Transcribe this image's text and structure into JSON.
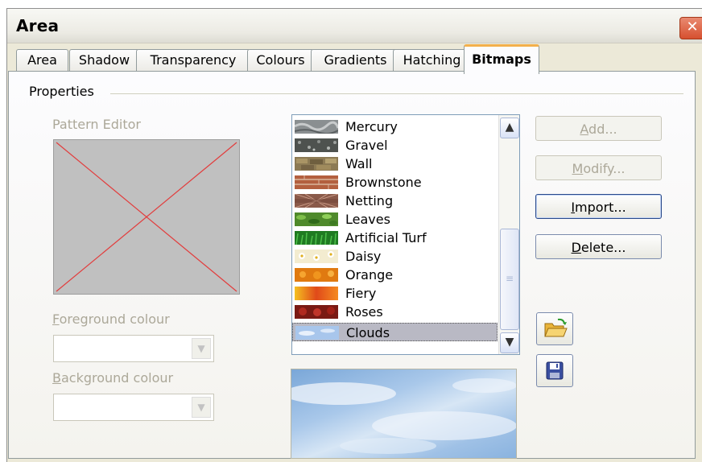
{
  "window": {
    "title": "Area",
    "close_glyph": "✕"
  },
  "tabs": [
    {
      "label": "Area"
    },
    {
      "label": "Shadow"
    },
    {
      "label": "Transparency"
    },
    {
      "label": "Colours"
    },
    {
      "label": "Gradients"
    },
    {
      "label": "Hatching"
    },
    {
      "label": "Bitmaps",
      "active": true
    }
  ],
  "properties": {
    "group_label": "Properties",
    "pattern_editor_label": "Pattern Editor",
    "foreground_label": "Foreground colour",
    "background_label": "Background colour",
    "foreground_value": "",
    "background_value": ""
  },
  "bitmaps": {
    "items": [
      {
        "name": "Mercury",
        "swatch": "#8a8f91"
      },
      {
        "name": "Gravel",
        "swatch": "#4e524f"
      },
      {
        "name": "Wall",
        "swatch": "#8c7a54"
      },
      {
        "name": "Brownstone",
        "swatch": "#a9553a"
      },
      {
        "name": "Netting",
        "swatch": "#8a5a4a"
      },
      {
        "name": "Leaves",
        "swatch": "#4f8a2c"
      },
      {
        "name": "Artificial Turf",
        "swatch": "#1f7a22"
      },
      {
        "name": "Daisy",
        "swatch": "#e8d9a4"
      },
      {
        "name": "Orange",
        "swatch": "#e07a10"
      },
      {
        "name": "Fiery",
        "swatch": "#e04a1a"
      },
      {
        "name": "Roses",
        "swatch": "#7a1a14"
      },
      {
        "name": "Clouds",
        "swatch": "#a8c6ec",
        "selected": true
      }
    ],
    "scroll_up_glyph": "▲",
    "scroll_down_glyph": "▼",
    "scroll_grip_glyph": "≡"
  },
  "buttons": {
    "add": {
      "label": "Add...",
      "mnemonic": "A",
      "rest": "dd..."
    },
    "modify": {
      "label": "Modify...",
      "mnemonic": "M",
      "rest": "odify..."
    },
    "import": {
      "label": "Import...",
      "mnemonic": "I",
      "rest": "mport..."
    },
    "delete": {
      "label": "Delete...",
      "mnemonic": "D",
      "rest": "elete..."
    }
  },
  "icons": {
    "load": "open-folder-icon",
    "save": "save-disk-icon"
  },
  "colors": {
    "accent_tab": "#f3b04c",
    "selection": "#b9b9c4",
    "disabled_text": "#aca899",
    "close_red": "#d6502f"
  }
}
